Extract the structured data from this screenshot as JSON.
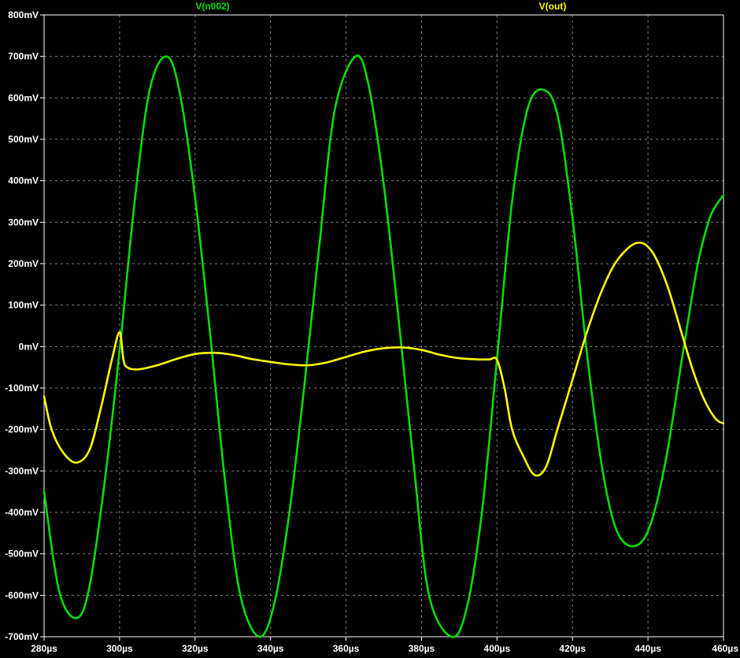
{
  "chart_data": {
    "type": "line",
    "title": "",
    "xlabel": "",
    "ylabel": "",
    "xlim": [
      280,
      460
    ],
    "ylim": [
      -700,
      800
    ],
    "x_unit": "µs",
    "y_unit": "mV",
    "x_ticks": [
      "280µs",
      "300µs",
      "320µs",
      "340µs",
      "360µs",
      "380µs",
      "400µs",
      "420µs",
      "440µs",
      "460µs"
    ],
    "y_ticks": [
      "800mV",
      "700mV",
      "600mV",
      "500mV",
      "400mV",
      "300mV",
      "200mV",
      "100mV",
      "0mV",
      "-100mV",
      "-200mV",
      "-300mV",
      "-400mV",
      "-500mV",
      "-600mV",
      "-700mV"
    ],
    "grid": true,
    "legend_position": "top",
    "series": [
      {
        "name": "V(n002)",
        "color": "#00e000",
        "x": [
          280,
          284,
          288.6,
          292,
          296,
          300,
          304,
          308,
          312.5,
          316,
          320,
          324,
          328,
          332,
          337,
          341,
          345,
          349,
          353,
          357,
          362.5,
          366,
          370,
          374,
          378,
          382,
          388,
          392,
          396,
          400,
          404,
          408,
          412,
          416,
          420,
          424,
          428,
          432,
          437,
          441,
          445,
          449,
          453,
          456,
          458,
          460
        ],
        "y": [
          -350,
          -590,
          -655,
          -580,
          -330,
          -10,
          350,
          620,
          700,
          610,
          360,
          30,
          -330,
          -600,
          -700,
          -620,
          -400,
          -90,
          250,
          570,
          700,
          630,
          390,
          60,
          -290,
          -600,
          -700,
          -630,
          -400,
          -30,
          350,
          570,
          620,
          560,
          310,
          -30,
          -300,
          -450,
          -480,
          -420,
          -260,
          -30,
          190,
          300,
          340,
          365
        ]
      },
      {
        "name": "V(out)",
        "color": "#ffff00",
        "x": [
          280,
          282,
          285,
          288.5,
          292,
          295,
          298,
          300,
          301,
          302,
          305,
          310,
          315,
          320,
          325,
          330,
          335,
          340,
          345,
          350,
          355,
          360,
          365,
          370,
          375,
          380,
          385,
          390,
          395,
          398,
          400,
          402,
          404,
          407,
          410,
          413,
          416,
          420,
          424,
          428,
          432,
          437,
          441,
          445,
          449,
          452,
          455,
          458,
          460
        ],
        "y": [
          -120,
          -200,
          -255,
          -280,
          -250,
          -150,
          -30,
          35,
          -30,
          -50,
          -55,
          -45,
          -30,
          -18,
          -15,
          -20,
          -30,
          -37,
          -43,
          -45,
          -38,
          -25,
          -12,
          -4,
          -2,
          -8,
          -20,
          -28,
          -31,
          -31,
          -32,
          -100,
          -200,
          -265,
          -310,
          -290,
          -200,
          -80,
          40,
          140,
          210,
          250,
          230,
          150,
          30,
          -60,
          -130,
          -175,
          -185
        ]
      }
    ]
  }
}
